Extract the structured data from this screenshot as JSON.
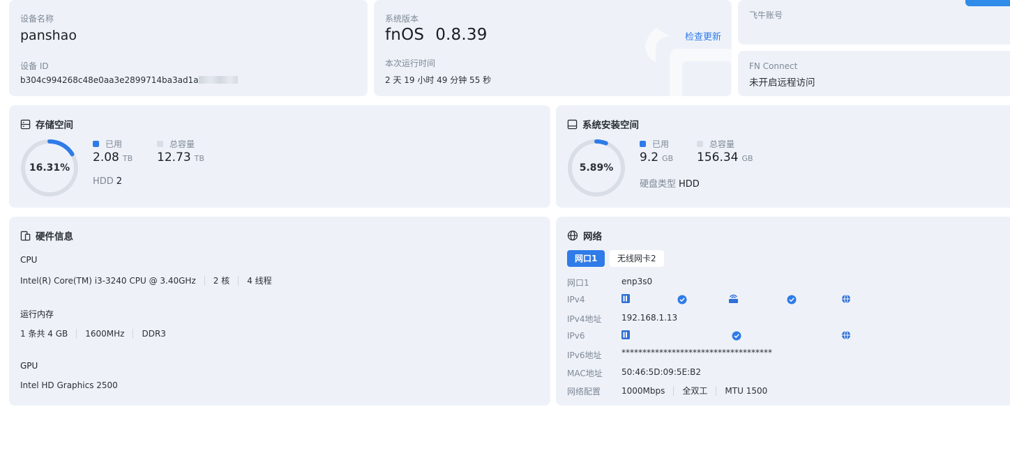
{
  "device": {
    "name_label": "设备名称",
    "name": "panshao",
    "id_label": "设备 ID",
    "id": "b304c994268c48e0aa3e2899714ba3ad1a"
  },
  "system": {
    "version_label": "系统版本",
    "os": "fnOS",
    "version": "0.8.39",
    "check_update": "检查更新",
    "uptime_label": "本次运行时间",
    "uptime": "2 天 19 小时 49 分钟 55 秒"
  },
  "account": {
    "label": "飞牛账号"
  },
  "connect": {
    "label": "FN Connect",
    "status": "未开启远程访问"
  },
  "storage": {
    "title": "存储空间",
    "percent_text": "16.31%",
    "percent": 16.31,
    "used_label": "已用",
    "used": "2.08",
    "used_unit": "TB",
    "total_label": "总容量",
    "total": "12.73",
    "total_unit": "TB",
    "disk_label": "HDD",
    "disk_count": "2"
  },
  "sysdisk": {
    "title": "系统安装空间",
    "percent_text": "5.89%",
    "percent": 5.89,
    "used_label": "已用",
    "used": "9.2",
    "used_unit": "GB",
    "total_label": "总容量",
    "total": "156.34",
    "total_unit": "GB",
    "type_label": "硬盘类型",
    "type": "HDD"
  },
  "hardware": {
    "title": "硬件信息",
    "cpu_label": "CPU",
    "cpu_model": "Intel(R) Core(TM) i3-3240 CPU @ 3.40GHz",
    "cpu_cores": "2 核",
    "cpu_threads": "4 线程",
    "mem_label": "运行内存",
    "mem_size": "1 条共 4 GB",
    "mem_freq": "1600MHz",
    "mem_type": "DDR3",
    "gpu_label": "GPU",
    "gpu_model": "Intel HD Graphics 2500"
  },
  "network": {
    "title": "网络",
    "tabs": [
      "网口1",
      "无线网卡2"
    ],
    "rows": {
      "port_label": "网口1",
      "port": "enp3s0",
      "ipv4_label": "IPv4",
      "ipv4_addr_label": "IPv4地址",
      "ipv4_addr": "192.168.1.13",
      "ipv6_label": "IPv6",
      "ipv6_addr_label": "IPv6地址",
      "ipv6_addr": "************************************",
      "mac_label": "MAC地址",
      "mac": "50:46:5D:09:5E:B2",
      "config_label": "网络配置",
      "speed": "1000Mbps",
      "duplex": "全双工",
      "mtu": "MTU 1500"
    }
  },
  "colors": {
    "accent": "#2f7be8",
    "card": "#eef2f8",
    "ring_track": "#d9dee6"
  }
}
